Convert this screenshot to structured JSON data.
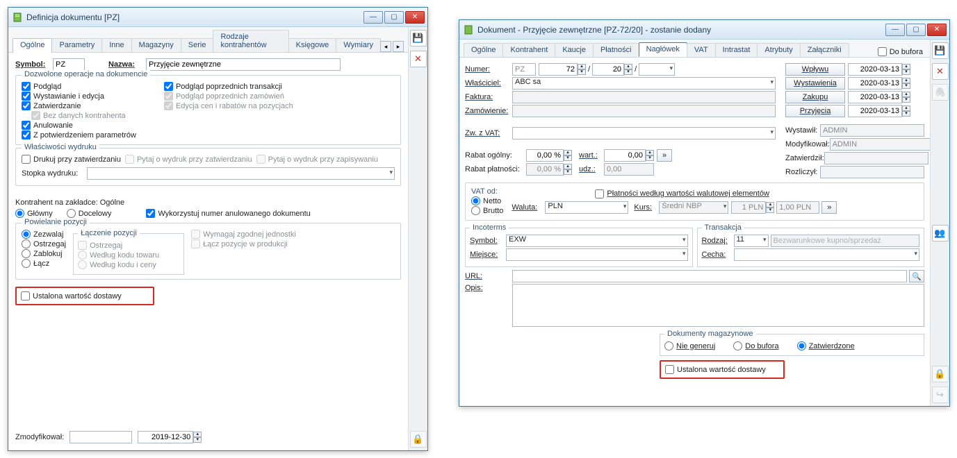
{
  "left": {
    "title": "Definicja dokumentu [PZ]",
    "tabs": [
      "Ogólne",
      "Parametry",
      "Inne",
      "Magazyny",
      "Serie",
      "Rodzaje kontrahentów",
      "Księgowe",
      "Wymiary"
    ],
    "activeTab": "Ogólne",
    "symbol_label": "Symbol:",
    "symbol": "PZ",
    "name_label": "Nazwa:",
    "name": "Przyjęcie zewnętrzne",
    "ops_legend": "Dozwolone operacje na dokumencie",
    "ops": {
      "podglad": "Podgląd",
      "wyst": "Wystawianie i edycja",
      "zatw": "Zatwierdzanie",
      "bez_kontr": "Bez danych kontrahenta",
      "anul": "Anulowanie",
      "z_potw": "Z potwierdzeniem parametrów",
      "podg_trans": "Podgląd poprzednich transakcji",
      "podg_zam": "Podgląd poprzednich zamówień",
      "edycja_cen": "Edycja cen i rabatów na pozycjach"
    },
    "print_legend": "Właściwości wydruku",
    "print": {
      "drukuj": "Drukuj przy zatwierdzaniu",
      "pytaj_zatw": "Pytaj o wydruk przy zatwierdzaniu",
      "pytaj_zap": "Pytaj o wydruk przy zapisywaniu",
      "stopka_label": "Stopka wydruku:"
    },
    "kontrahent_label": "Kontrahent na zakładce: Ogólne",
    "kontr_glowny": "Główny",
    "kontr_docelowy": "Docelowy",
    "wykorzystuj": "Wykorzystuj numer anulowanego dokumentu",
    "pow_legend": "Powielanie pozycji",
    "pow": {
      "zezwalaj": "Zezwalaj",
      "ostrzegaj": "Ostrzegaj",
      "zablokuj": "Zablokuj",
      "lacz": "Łącz"
    },
    "lacz_legend": "Łączenie pozycji",
    "lacz": {
      "ostrzegaj": "Ostrzegaj",
      "kod": "Według kodu towaru",
      "kod_cena": "Według kodu i ceny"
    },
    "wymagaj_jedn": "Wymagaj zgodnej jednostki",
    "lacz_prod": "Łącz pozycje w produkcji",
    "ustalona": "Ustalona wartość dostawy",
    "mod_label": "Zmodyfikował:",
    "mod_date": "2019-12-30"
  },
  "right": {
    "title": "Dokument - Przyjęcie zewnętrzne [PZ-72/20]  - zostanie dodany",
    "tabs": [
      "Ogólne",
      "Kontrahent",
      "Kaucje",
      "Płatności",
      "Nagłówek",
      "VAT",
      "Intrastat",
      "Atrybuty",
      "Załączniki"
    ],
    "activeTab": "Nagłówek",
    "do_bufora": "Do bufora",
    "numer_label": "Numer:",
    "numer_sym": "PZ",
    "numer_a": "72",
    "numer_b": "20",
    "wlasciciel_label": "Właściciel:",
    "wlasciciel": "ABC sa",
    "faktura_label": "Faktura:",
    "zamowienie_label": "Zamówienie:",
    "zw_vat_label": "Zw. z VAT:",
    "btn_wplywu": "Wpływu",
    "btn_wyst": "Wystawienia",
    "btn_zakupu": "Zakupu",
    "btn_przyj": "Przyjęcia",
    "date": "2020-03-13",
    "wystawil_label": "Wystawił:",
    "modyf_label": "Modyfikował:",
    "zatw_label": "Zatwierdził:",
    "rozl_label": "Rozliczył:",
    "admin": "ADMIN",
    "rabat_og_label": "Rabat ogólny:",
    "rabat_og": "0,00 %",
    "wart_label": "wart.:",
    "wart": "0,00",
    "rabat_pl_label": "Rabat płatności:",
    "rabat_pl": "0,00 %",
    "udz_label": "udz.:",
    "udz": "0,00",
    "vat_od_legend": "VAT od:",
    "netto": "Netto",
    "brutto": "Brutto",
    "platnosci_wg": "Płatności według wartości walutowej elementów",
    "waluta_label": "Waluta:",
    "waluta": "PLN",
    "kurs_label": "Kurs:",
    "kurs_typ": "Średni NBP",
    "kurs_a": "1 PLN",
    "kurs_b": "1,00 PLN",
    "incoterms_legend": "Incoterms",
    "symbol_label": "Symbol:",
    "incoterms_sym": "EXW",
    "miejsce_label": "Miejsce:",
    "transakcja_legend": "Transakcja",
    "rodzaj_label": "Rodzaj:",
    "rodzaj": "11",
    "rodzaj_opis": "Bezwarunkowe kupno/sprzedaż",
    "cecha_label": "Cecha:",
    "url_label": "URL:",
    "opis_label": "Opis:",
    "dokmag_legend": "Dokumenty magazynowe",
    "nie_gen": "Nie generuj",
    "do_buf": "Do bufora",
    "zatw": "Zatwierdzone",
    "ustalona": "Ustalona wartość dostawy"
  }
}
